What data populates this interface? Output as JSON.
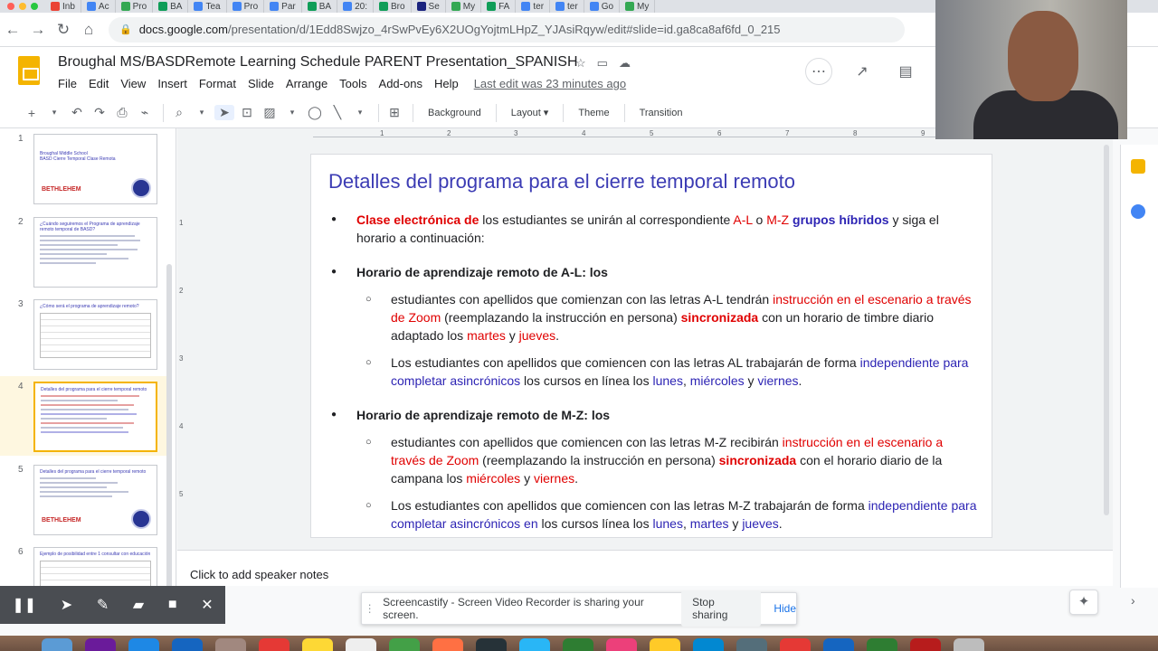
{
  "browser": {
    "tabs": [
      {
        "label": "Inb",
        "color": "#ea4335"
      },
      {
        "label": "Ac",
        "color": "#4285f4"
      },
      {
        "label": "Pro",
        "color": "#34a853"
      },
      {
        "label": "BA",
        "color": "#0f9d58"
      },
      {
        "label": "Tea",
        "color": "#4285f4"
      },
      {
        "label": "Pro",
        "color": "#4285f4"
      },
      {
        "label": "Par",
        "color": "#4285f4"
      },
      {
        "label": "BA",
        "color": "#0f9d58"
      },
      {
        "label": "20:",
        "color": "#4285f4"
      },
      {
        "label": "Bro",
        "color": "#0f9d58"
      },
      {
        "label": "Se",
        "color": "#1a237e"
      },
      {
        "label": "My",
        "color": "#34a853"
      },
      {
        "label": "FA",
        "color": "#0f9d58"
      },
      {
        "label": "ter",
        "color": "#4285f4"
      },
      {
        "label": "ter",
        "color": "#4285f4"
      },
      {
        "label": "Go",
        "color": "#4285f4"
      },
      {
        "label": "My",
        "color": "#34a853"
      }
    ],
    "url_host": "docs.google.com",
    "url_path": "/presentation/d/1Edd8Swjzo_4rSwPvEy6X2UOgYojtmLHpZ_YJAsiRqyw/edit#slide=id.ga8ca8af6fd_0_215"
  },
  "doc": {
    "title": "Broughal MS/BASDRemote Learning Schedule PARENT Presentation_SPANISH",
    "last_edit": "Last edit was 23 minutes ago",
    "menu": [
      "File",
      "Edit",
      "View",
      "Insert",
      "Format",
      "Slide",
      "Arrange",
      "Tools",
      "Add-ons",
      "Help"
    ]
  },
  "toolbar": {
    "background": "Background",
    "layout": "Layout",
    "theme": "Theme",
    "transition": "Transition"
  },
  "filmstrip": {
    "slides": [
      {
        "num": "1",
        "title": "Broughal Middle School\nBASD Cierre Temporal Clase Remota",
        "kind": "title"
      },
      {
        "num": "2",
        "title": "¿Cuándo seguiremos el Programa de aprendizaje remoto temporal de BASD?",
        "kind": "text"
      },
      {
        "num": "3",
        "title": "¿Cómo será el programa de aprendizaje remoto?",
        "kind": "table"
      },
      {
        "num": "4",
        "title": "Detalles del programa para el cierre temporal remoto",
        "kind": "text"
      },
      {
        "num": "5",
        "title": "Detalles del programa para el cierre temporal remoto",
        "kind": "logo"
      },
      {
        "num": "6",
        "title": "Ejemplo de posibilidad entre 1 consultar con educación",
        "kind": "table"
      }
    ],
    "logo_text": "BETHLEHEM"
  },
  "ruler": {
    "top": [
      "1",
      "2",
      "3",
      "4",
      "5",
      "6",
      "7",
      "8",
      "9"
    ],
    "left": [
      "1",
      "2",
      "3",
      "4",
      "5"
    ]
  },
  "slide": {
    "title": "Detalles del programa para el cierre temporal remoto",
    "bullet1": {
      "a": "Clase electrónica de",
      "b": " los estudiantes se unirán al correspondiente ",
      "c": "A-L",
      "d": " o ",
      "e": "M-Z",
      "f": " grupos híbridos",
      "g": " y siga el horario a continuación:"
    },
    "bullet2": "Horario de aprendizaje remoto de A-L: los",
    "sub1": {
      "a": "estudiantes con apellidos que comienzan con las letras A-L tendrán ",
      "b": "instrucción en el escenario a través de Zoom",
      "c": " (reemplazando la instrucción en persona) ",
      "d": "sincronizada",
      "e": " con un horario de timbre diario adaptado los ",
      "f": "martes",
      "g": " y ",
      "h": "jueves",
      "i": "."
    },
    "sub2": {
      "a": "Los estudiantes con apellidos que comiencen con las letras AL trabajarán de forma ",
      "b": "independiente para completar asincrónicos",
      "c": " los cursos en línea los ",
      "d": "lunes",
      "e": ", ",
      "f": "miércoles",
      "g": " y ",
      "h": "viernes",
      "i": "."
    },
    "bullet3": "Horario de aprendizaje remoto de M-Z: los",
    "sub3": {
      "a": "estudiantes con apellidos que comiencen con las letras M-Z recibirán ",
      "b": "instrucción en el escenario a través de Zoom",
      "c": " (reemplazando la instrucción en persona) ",
      "d": "sincronizada",
      "e": " con el horario diario de la campana los ",
      "f": "miércoles",
      "g": " y ",
      "h": "viernes",
      "i": "."
    },
    "sub4": {
      "a": "Los estudiantes con apellidos que comiencen con las letras M-Z trabajarán de forma ",
      "b": "independiente para completar asincrónicos en",
      "c": " los cursos línea los ",
      "d": "lunes",
      "e": ", ",
      "f": "martes",
      "g": " y ",
      "h": "jueves",
      "i": "."
    }
  },
  "notes": {
    "placeholder": "Click to add speaker notes"
  },
  "screencastify": {
    "message": "Screencastify - Screen Video Recorder is sharing your screen.",
    "stop": "Stop sharing",
    "hide": "Hide"
  },
  "colors": {
    "accent": "#f4b400",
    "title_blue": "#3c3cb4",
    "emph_red": "#e00000",
    "emph_blue": "#2d24b4"
  }
}
